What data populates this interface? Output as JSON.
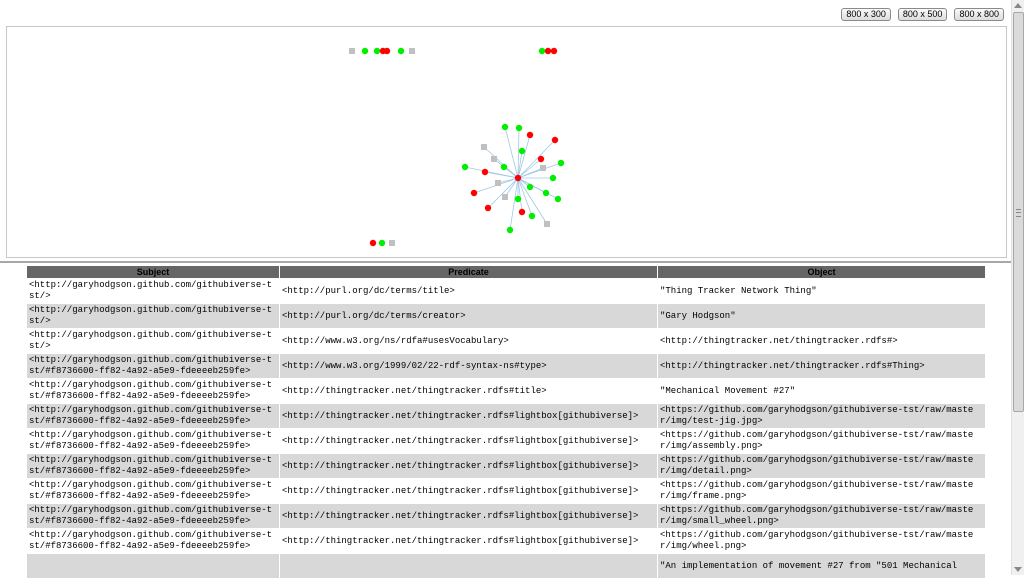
{
  "toolbar": {
    "sizes": [
      "800 x 300",
      "800 x 500",
      "800 x 800"
    ]
  },
  "graph": {
    "node_colors": {
      "literal": "#ff0000",
      "resource": "#00ee00",
      "blank": "#c0c0c0"
    },
    "link_color": "#9ec9e6",
    "clusters": [
      {
        "center": null,
        "nodes": [
          "blank",
          "resource",
          "resource",
          "literal",
          "literal",
          "resource",
          "blank"
        ]
      },
      {
        "center": null,
        "nodes": [
          "resource",
          "literal",
          "literal"
        ]
      },
      {
        "center": "literal",
        "nodes": [
          "resource",
          "resource",
          "literal",
          "literal",
          "blank",
          "resource",
          "literal",
          "resource",
          "blank",
          "resource",
          "blank",
          "resource",
          "literal",
          "resource",
          "blank",
          "resource",
          "literal",
          "resource",
          "blank",
          "resource",
          "literal",
          "resource",
          "literal",
          "resource",
          "blank",
          "resource"
        ]
      },
      {
        "center": null,
        "nodes": [
          "literal",
          "resource",
          "blank"
        ]
      }
    ]
  },
  "table": {
    "headers": {
      "subject": "Subject",
      "predicate": "Predicate",
      "object": "Object"
    },
    "header_bg": "#666666",
    "rows": [
      {
        "subject": "<http://garyhodgson.github.com/githubiverse-tst/>",
        "predicate": "<http://purl.org/dc/terms/title>",
        "object": "\"Thing Tracker Network Thing\""
      },
      {
        "subject": "<http://garyhodgson.github.com/githubiverse-tst/>",
        "predicate": "<http://purl.org/dc/terms/creator>",
        "object": "\"Gary Hodgson\""
      },
      {
        "subject": "<http://garyhodgson.github.com/githubiverse-tst/>",
        "predicate": "<http://www.w3.org/ns/rdfa#usesVocabulary>",
        "object": "<http://thingtracker.net/thingtracker.rdfs#>"
      },
      {
        "subject": "<http://garyhodgson.github.com/githubiverse-tst/#f8736600-ff82-4a92-a5e9-fdeeeeb259fe>",
        "predicate": "<http://www.w3.org/1999/02/22-rdf-syntax-ns#type>",
        "object": "<http://thingtracker.net/thingtracker.rdfs#Thing>"
      },
      {
        "subject": "<http://garyhodgson.github.com/githubiverse-tst/#f8736600-ff82-4a92-a5e9-fdeeeeb259fe>",
        "predicate": "<http://thingtracker.net/thingtracker.rdfs#title>",
        "object": "\"Mechanical Movement #27\""
      },
      {
        "subject": "<http://garyhodgson.github.com/githubiverse-tst/#f8736600-ff82-4a92-a5e9-fdeeeeb259fe>",
        "predicate": "<http://thingtracker.net/thingtracker.rdfs#lightbox[githubiverse]>",
        "object": "<https://github.com/garyhodgson/githubiverse-tst/raw/master/img/test-jig.jpg>"
      },
      {
        "subject": "<http://garyhodgson.github.com/githubiverse-tst/#f8736600-ff82-4a92-a5e9-fdeeeeb259fe>",
        "predicate": "<http://thingtracker.net/thingtracker.rdfs#lightbox[githubiverse]>",
        "object": "<https://github.com/garyhodgson/githubiverse-tst/raw/master/img/assembly.png>"
      },
      {
        "subject": "<http://garyhodgson.github.com/githubiverse-tst/#f8736600-ff82-4a92-a5e9-fdeeeeb259fe>",
        "predicate": "<http://thingtracker.net/thingtracker.rdfs#lightbox[githubiverse]>",
        "object": "<https://github.com/garyhodgson/githubiverse-tst/raw/master/img/detail.png>"
      },
      {
        "subject": "<http://garyhodgson.github.com/githubiverse-tst/#f8736600-ff82-4a92-a5e9-fdeeeeb259fe>",
        "predicate": "<http://thingtracker.net/thingtracker.rdfs#lightbox[githubiverse]>",
        "object": "<https://github.com/garyhodgson/githubiverse-tst/raw/master/img/frame.png>"
      },
      {
        "subject": "<http://garyhodgson.github.com/githubiverse-tst/#f8736600-ff82-4a92-a5e9-fdeeeeb259fe>",
        "predicate": "<http://thingtracker.net/thingtracker.rdfs#lightbox[githubiverse]>",
        "object": "<https://github.com/garyhodgson/githubiverse-tst/raw/master/img/small_wheel.png>"
      },
      {
        "subject": "<http://garyhodgson.github.com/githubiverse-tst/#f8736600-ff82-4a92-a5e9-fdeeeeb259fe>",
        "predicate": "<http://thingtracker.net/thingtracker.rdfs#lightbox[githubiverse]>",
        "object": "<https://github.com/garyhodgson/githubiverse-tst/raw/master/img/wheel.png>"
      },
      {
        "subject": "",
        "predicate": "",
        "object": "\"An implementation of movement #27 from \"501 Mechanical"
      }
    ]
  }
}
